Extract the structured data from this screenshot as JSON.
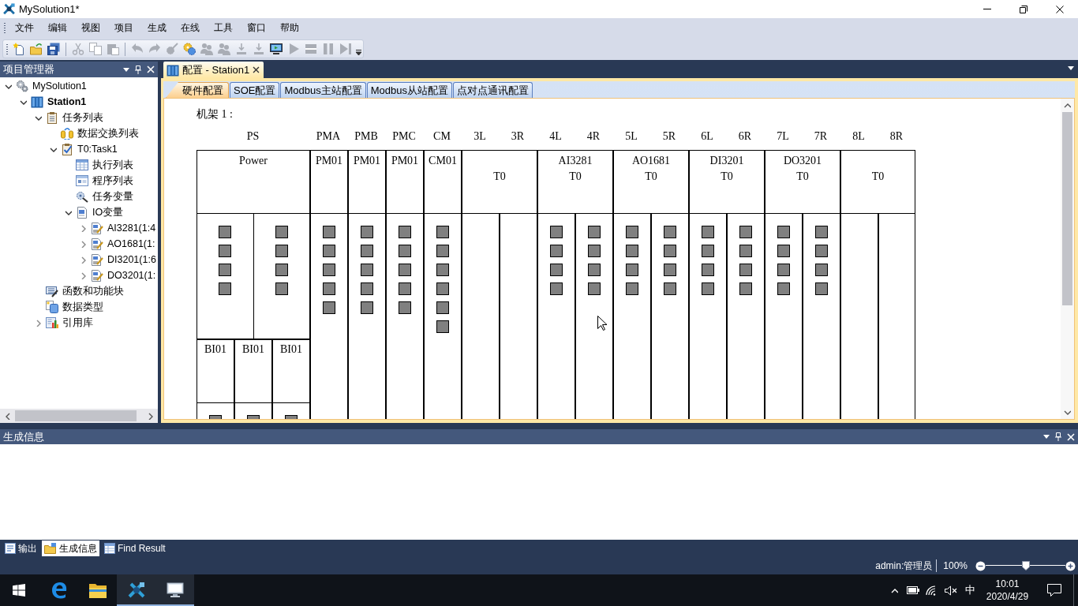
{
  "window": {
    "title": "MySolution1*"
  },
  "menu": [
    "文件",
    "编辑",
    "视图",
    "项目",
    "生成",
    "在线",
    "工具",
    "窗口",
    "帮助"
  ],
  "toolbar": {
    "groups": [
      {
        "buttons": [
          {
            "kind": "new",
            "disabled": false
          },
          {
            "kind": "open",
            "disabled": false
          },
          {
            "kind": "save",
            "disabled": false
          }
        ]
      },
      {
        "buttons": [
          {
            "kind": "cut",
            "disabled": true
          },
          {
            "kind": "copy",
            "disabled": true
          },
          {
            "kind": "paste",
            "disabled": true
          }
        ]
      },
      {
        "buttons": [
          {
            "kind": "undo",
            "disabled": true
          },
          {
            "kind": "redo",
            "disabled": true
          },
          {
            "kind": "build",
            "disabled": true
          },
          {
            "kind": "build_all",
            "disabled": false
          },
          {
            "kind": "users",
            "disabled": true
          },
          {
            "kind": "users",
            "disabled": true
          },
          {
            "kind": "download",
            "disabled": true
          },
          {
            "kind": "upload",
            "disabled": true
          },
          {
            "kind": "monitor",
            "disabled": false
          },
          {
            "kind": "run",
            "disabled": true
          },
          {
            "kind": "stop",
            "disabled": true
          },
          {
            "kind": "pause",
            "disabled": true
          },
          {
            "kind": "step",
            "disabled": true
          }
        ]
      }
    ]
  },
  "project_panel": {
    "title": "项目管理器",
    "tree": [
      {
        "label": "MySolution1",
        "kind": "solution",
        "expanded": true,
        "children": [
          {
            "label": "Station1",
            "kind": "station",
            "expanded": true,
            "children": [
              {
                "label": "任务列表",
                "kind": "task_list",
                "expanded": true,
                "children": [
                  {
                    "label": "数据交换列表",
                    "kind": "exchange"
                  },
                  {
                    "label": "T0:Task1",
                    "kind": "task",
                    "expanded": true,
                    "children": [
                      {
                        "label": "执行列表",
                        "kind": "exec_list"
                      },
                      {
                        "label": "程序列表",
                        "kind": "program_list"
                      },
                      {
                        "label": "任务变量",
                        "kind": "task_vars"
                      },
                      {
                        "label": "IO变量",
                        "kind": "io_vars",
                        "expanded": true,
                        "children": [
                          {
                            "label": "AI3281(1:4",
                            "kind": "io_module",
                            "expanded": false
                          },
                          {
                            "label": "AO1681(1:",
                            "kind": "io_module",
                            "expanded": false
                          },
                          {
                            "label": "DI3201(1:6",
                            "kind": "io_module",
                            "expanded": false
                          },
                          {
                            "label": "DO3201(1:",
                            "kind": "io_module",
                            "expanded": false
                          }
                        ]
                      }
                    ]
                  }
                ]
              },
              {
                "label": "函数和功能块",
                "kind": "functions"
              },
              {
                "label": "数据类型",
                "kind": "data_types"
              },
              {
                "label": "引用库",
                "kind": "library",
                "expanded": false
              }
            ]
          }
        ]
      }
    ]
  },
  "document_tabs": [
    {
      "title": "配置 - Station1",
      "selected": true
    }
  ],
  "config_tabs": [
    {
      "label": "硬件配置",
      "selected": true
    },
    {
      "label": "SOE配置",
      "selected": false
    },
    {
      "label": "Modbus主站配置",
      "selected": false
    },
    {
      "label": "Modbus从站配置",
      "selected": false
    },
    {
      "label": "点对点通讯配置",
      "selected": false
    }
  ],
  "rack": {
    "title": "机架 1 :",
    "modules": [
      {
        "kind": "power",
        "slots": [
          "PS"
        ],
        "model": "Power",
        "cards": [
          "BI01",
          "BI01",
          "BI01"
        ]
      },
      {
        "kind": "processor",
        "slots": [
          "PMA"
        ],
        "model": "PM01"
      },
      {
        "kind": "processor",
        "slots": [
          "PMB"
        ],
        "model": "PM01"
      },
      {
        "kind": "processor",
        "slots": [
          "PMC"
        ],
        "model": "PM01"
      },
      {
        "kind": "comm",
        "slots": [
          "CM"
        ],
        "model": "CM01"
      },
      {
        "kind": "io_empty",
        "slots": [
          "3L",
          "3R"
        ],
        "task": "T0"
      },
      {
        "kind": "io",
        "slots": [
          "4L",
          "4R"
        ],
        "model": "AI3281",
        "task": "T0"
      },
      {
        "kind": "io",
        "slots": [
          "5L",
          "5R"
        ],
        "model": "AO1681",
        "task": "T0"
      },
      {
        "kind": "io",
        "slots": [
          "6L",
          "6R"
        ],
        "model": "DI3201",
        "task": "T0"
      },
      {
        "kind": "io",
        "slots": [
          "7L",
          "7R"
        ],
        "model": "DO3201",
        "task": "T0"
      },
      {
        "kind": "io_empty",
        "slots": [
          "8L",
          "8R"
        ],
        "task": "T0"
      }
    ]
  },
  "output_panel": {
    "title": "生成信息",
    "tabs": [
      {
        "label": "输出",
        "kind": "output",
        "selected": false
      },
      {
        "label": "生成信息",
        "kind": "build",
        "selected": true
      },
      {
        "label": "Find Result",
        "kind": "find",
        "selected": false
      }
    ]
  },
  "status_bar": {
    "user": "admin:管理员",
    "zoom": "100%",
    "zoom_slider": {
      "level": 0.5
    }
  },
  "taskbar": {
    "apps": [
      {
        "kind": "browser",
        "running": false
      },
      {
        "kind": "folder",
        "running": false
      },
      {
        "kind": "tools",
        "running": true
      },
      {
        "kind": "monitor",
        "running": true
      }
    ],
    "tray": {
      "volume_muted": true,
      "ime": "中",
      "time": "10:01",
      "date": "2020/4/29"
    }
  }
}
